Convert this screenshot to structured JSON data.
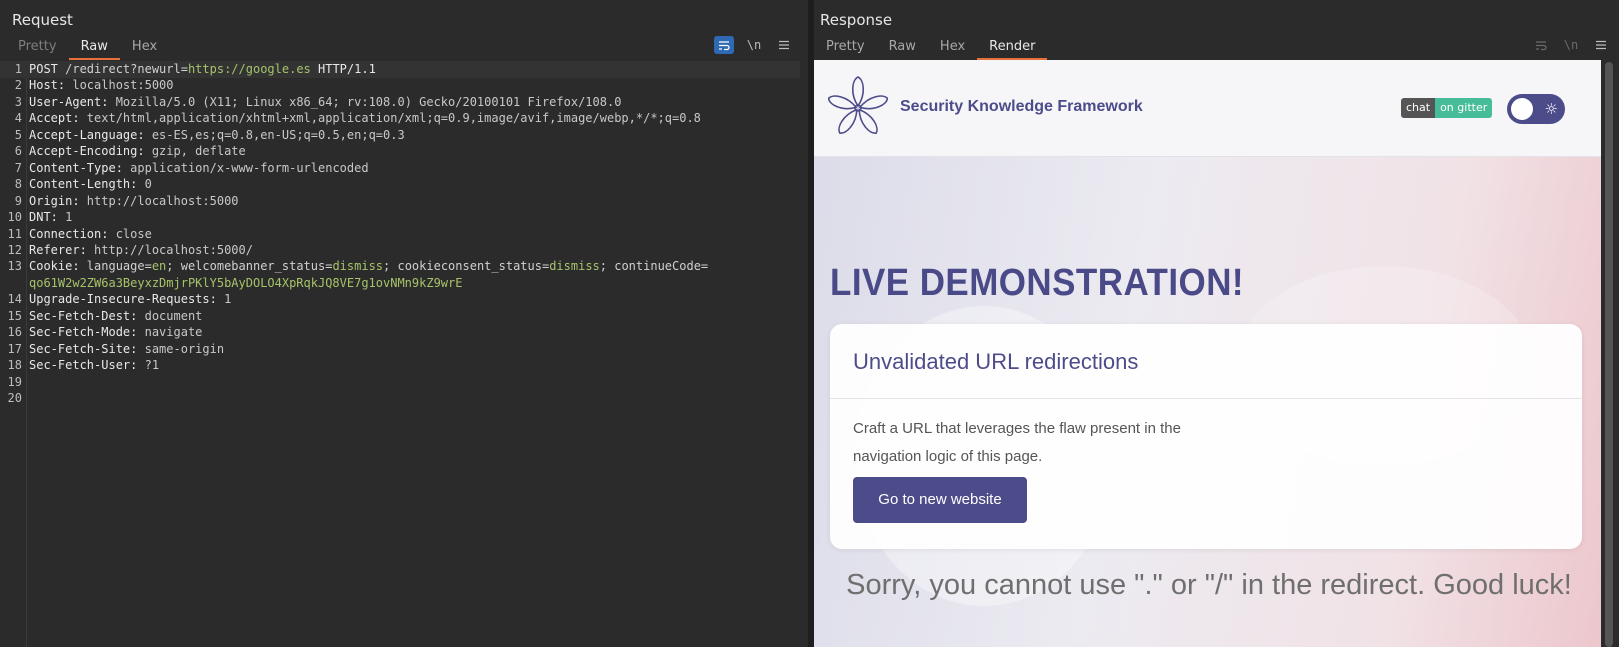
{
  "layout_buttons": [
    "side-by-side-layout-icon",
    "stacked-layout-icon",
    "single-pane-layout-icon"
  ],
  "request": {
    "title": "Request",
    "tabs": [
      "Pretty",
      "Raw",
      "Hex"
    ],
    "active_tab": "Raw",
    "tools": [
      "wrap-icon",
      "\\n",
      "menu-icon"
    ],
    "lines": [
      {
        "n": "1",
        "parts": [
          {
            "t": "POST ",
            "c": "k"
          },
          {
            "t": "/redirect?newurl=",
            "c": "w"
          },
          {
            "t": "https://google.es",
            "c": "g"
          },
          {
            "t": " HTTP/1.1",
            "c": "k"
          }
        ]
      },
      {
        "n": "2",
        "parts": [
          {
            "t": "Host: ",
            "c": "k"
          },
          {
            "t": "localhost:5000",
            "c": "v"
          }
        ]
      },
      {
        "n": "3",
        "parts": [
          {
            "t": "User-Agent: ",
            "c": "k"
          },
          {
            "t": "Mozilla/5.0 (X11; Linux x86_64; rv:108.0) Gecko/20100101 Firefox/108.0",
            "c": "v"
          }
        ]
      },
      {
        "n": "4",
        "parts": [
          {
            "t": "Accept: ",
            "c": "k"
          },
          {
            "t": "text/html,application/xhtml+xml,application/xml;q=0.9,image/avif,image/webp,*/*;q=0.8",
            "c": "v"
          }
        ]
      },
      {
        "n": "5",
        "parts": [
          {
            "t": "Accept-Language: ",
            "c": "k"
          },
          {
            "t": "es-ES,es;q=0.8,en-US;q=0.5,en;q=0.3",
            "c": "v"
          }
        ]
      },
      {
        "n": "6",
        "parts": [
          {
            "t": "Accept-Encoding: ",
            "c": "k"
          },
          {
            "t": "gzip, deflate",
            "c": "v"
          }
        ]
      },
      {
        "n": "7",
        "parts": [
          {
            "t": "Content-Type: ",
            "c": "k"
          },
          {
            "t": "application/x-www-form-urlencoded",
            "c": "v"
          }
        ]
      },
      {
        "n": "8",
        "parts": [
          {
            "t": "Content-Length: ",
            "c": "k"
          },
          {
            "t": "0",
            "c": "v"
          }
        ]
      },
      {
        "n": "9",
        "parts": [
          {
            "t": "Origin: ",
            "c": "k"
          },
          {
            "t": "http://localhost:5000",
            "c": "v"
          }
        ]
      },
      {
        "n": "10",
        "parts": [
          {
            "t": "DNT: ",
            "c": "k"
          },
          {
            "t": "1",
            "c": "v"
          }
        ]
      },
      {
        "n": "11",
        "parts": [
          {
            "t": "Connection: ",
            "c": "k"
          },
          {
            "t": "close",
            "c": "v"
          }
        ]
      },
      {
        "n": "12",
        "parts": [
          {
            "t": "Referer: ",
            "c": "k"
          },
          {
            "t": "http://localhost:5000/",
            "c": "v"
          }
        ]
      },
      {
        "n": "13",
        "parts": [
          {
            "t": "Cookie: ",
            "c": "k"
          },
          {
            "t": "language=",
            "c": "w"
          },
          {
            "t": "en",
            "c": "g"
          },
          {
            "t": "; welcomebanner_status=",
            "c": "w"
          },
          {
            "t": "dismiss",
            "c": "g"
          },
          {
            "t": "; cookieconsent_status=",
            "c": "w"
          },
          {
            "t": "dismiss",
            "c": "g"
          },
          {
            "t": "; continueCode=",
            "c": "w"
          }
        ]
      },
      {
        "n": "",
        "parts": [
          {
            "t": "qo61W2w2ZW6a3BeyxzDmjrPKlY5bAyDOLO4XpRqkJQ8VE7g1ovNMn9kZ9wrE",
            "c": "g"
          }
        ]
      },
      {
        "n": "14",
        "parts": [
          {
            "t": "Upgrade-Insecure-Requests: ",
            "c": "k"
          },
          {
            "t": "1",
            "c": "v"
          }
        ]
      },
      {
        "n": "15",
        "parts": [
          {
            "t": "Sec-Fetch-Dest: ",
            "c": "k"
          },
          {
            "t": "document",
            "c": "v"
          }
        ]
      },
      {
        "n": "16",
        "parts": [
          {
            "t": "Sec-Fetch-Mode: ",
            "c": "k"
          },
          {
            "t": "navigate",
            "c": "v"
          }
        ]
      },
      {
        "n": "17",
        "parts": [
          {
            "t": "Sec-Fetch-Site: ",
            "c": "k"
          },
          {
            "t": "same-origin",
            "c": "v"
          }
        ]
      },
      {
        "n": "18",
        "parts": [
          {
            "t": "Sec-Fetch-User: ",
            "c": "k"
          },
          {
            "t": "?1",
            "c": "v"
          }
        ]
      },
      {
        "n": "19",
        "parts": []
      },
      {
        "n": "20",
        "parts": []
      }
    ]
  },
  "response": {
    "title": "Response",
    "tabs": [
      "Pretty",
      "Raw",
      "Hex",
      "Render"
    ],
    "active_tab": "Render",
    "tools": [
      "wrap-icon",
      "\\n",
      "menu-icon"
    ],
    "render": {
      "brand": "Security Knowledge Framework",
      "badge_left": "chat",
      "badge_right": "on gitter",
      "headline": "LIVE DEMONSTRATION!",
      "card_title": "Unvalidated URL redirections",
      "card_text": "Craft a URL that leverages the flaw present in the navigation logic of this page.",
      "button_label": "Go to new website",
      "sorry_text": "Sorry, you cannot use \".\" or \"/\" in the redirect. Good luck!"
    }
  },
  "colors": {
    "accent": "#2e6ab4",
    "active_tab_underline": "#e8713b",
    "brand_purple": "#4d4c8a",
    "gitter_green": "#46bc99",
    "string_green": "#a6c36a"
  }
}
